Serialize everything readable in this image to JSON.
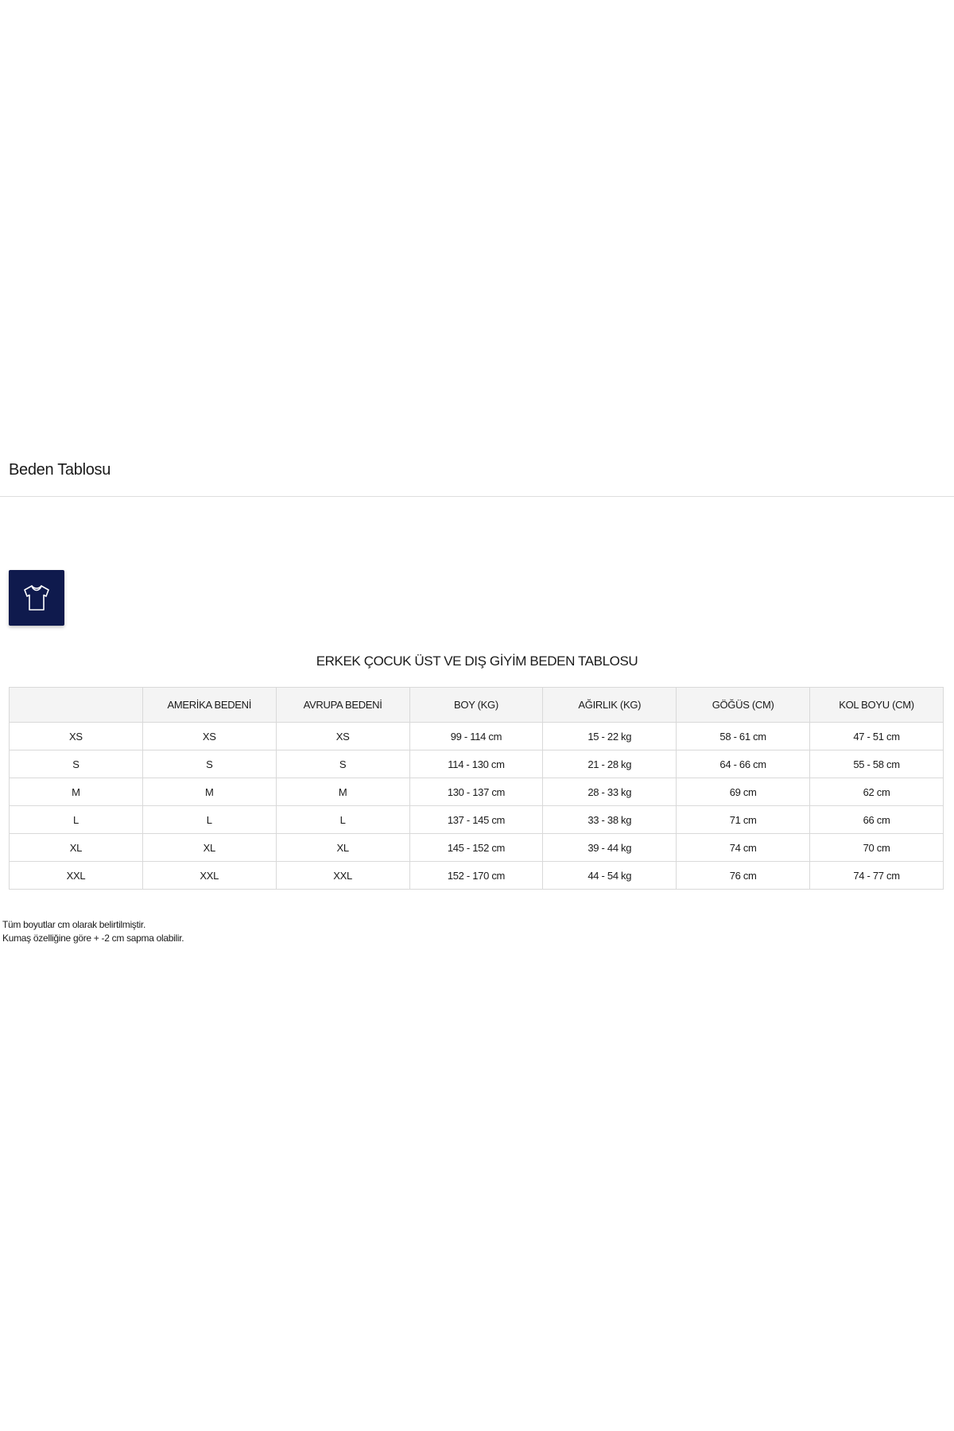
{
  "page": {
    "title": "Beden Tablosu"
  },
  "category": {
    "icon": "tshirt-icon",
    "tile_color": "#0f1a4d"
  },
  "size_table": {
    "title": "ERKEK ÇOCUK ÜST VE DIŞ GİYİM BEDEN TABLOSU",
    "headers": [
      "",
      "AMERİKA BEDENİ",
      "AVRUPA BEDENİ",
      "BOY (KG)",
      "AĞIRLIK (KG)",
      "GÖĞÜS (CM)",
      "KOL BOYU (CM)"
    ],
    "rows": [
      [
        "XS",
        "XS",
        "XS",
        "99 - 114 cm",
        "15 - 22 kg",
        "58 - 61 cm",
        "47 - 51 cm"
      ],
      [
        "S",
        "S",
        "S",
        "114 - 130 cm",
        "21 - 28 kg",
        "64 - 66 cm",
        "55 - 58 cm"
      ],
      [
        "M",
        "M",
        "M",
        "130 - 137 cm",
        "28 - 33 kg",
        "69 cm",
        "62 cm"
      ],
      [
        "L",
        "L",
        "L",
        "137 - 145 cm",
        "33 - 38 kg",
        "71 cm",
        "66 cm"
      ],
      [
        "XL",
        "XL",
        "XL",
        "145 - 152 cm",
        "39 - 44 kg",
        "74 cm",
        "70 cm"
      ],
      [
        "XXL",
        "XXL",
        "XXL",
        "152 - 170 cm",
        "44 - 54 kg",
        "76 cm",
        "74 - 77 cm"
      ]
    ]
  },
  "footnotes": [
    "Tüm boyutlar cm olarak belirtilmiştir.",
    "Kumaş özelliğine göre + -2 cm sapma olabilir."
  ]
}
